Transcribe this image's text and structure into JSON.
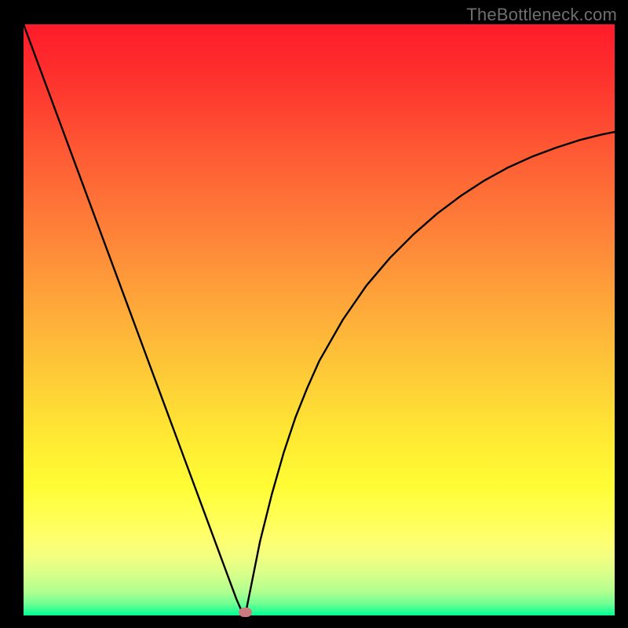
{
  "watermark": "TheBottleneck.com",
  "chart_data": {
    "type": "line",
    "title": "",
    "xlabel": "",
    "ylabel": "",
    "xlim": [
      0,
      100
    ],
    "ylim": [
      0,
      100
    ],
    "x": [
      0,
      2,
      4,
      6,
      8,
      10,
      12,
      14,
      16,
      18,
      20,
      22,
      24,
      26,
      28,
      30,
      32,
      33,
      34,
      35,
      36,
      37,
      37.5,
      38,
      40,
      42,
      44,
      46,
      48,
      50,
      54,
      58,
      62,
      66,
      70,
      74,
      78,
      82,
      86,
      90,
      94,
      98,
      100
    ],
    "y": [
      100,
      94.6,
      89.2,
      83.8,
      78.4,
      73.0,
      67.6,
      62.2,
      56.8,
      51.4,
      46.0,
      40.6,
      35.2,
      29.8,
      24.4,
      19.0,
      13.6,
      10.9,
      8.2,
      5.5,
      2.8,
      0.5,
      0.0,
      2.5,
      12.5,
      20.5,
      27.5,
      33.5,
      38.5,
      43.0,
      50.0,
      55.8,
      60.5,
      64.5,
      68.0,
      71.0,
      73.6,
      75.8,
      77.6,
      79.1,
      80.4,
      81.4,
      81.8
    ],
    "marker": {
      "x": 37.5,
      "y": 0.5
    },
    "background_gradient": "red-yellow-green vertical"
  }
}
